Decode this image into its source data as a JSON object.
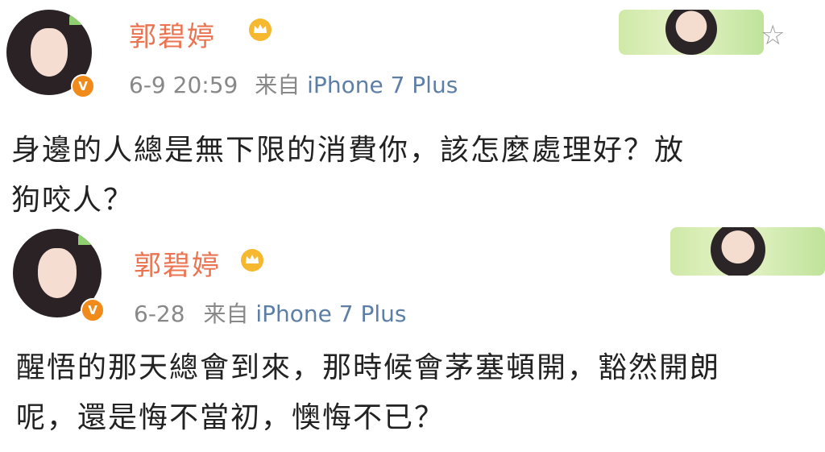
{
  "posts": [
    {
      "username": "郭碧婷",
      "time": "6-9 20:59",
      "via": "来自",
      "source": "iPhone 7 Plus",
      "verified_badge": "V",
      "content_lines": [
        "身邊的人總是無下限的消費你，該怎麼處理好？放",
        "狗咬人？"
      ]
    },
    {
      "username": "郭碧婷",
      "time": "6-28",
      "via": "来自",
      "source": "iPhone 7 Plus",
      "verified_badge": "V",
      "content_lines": [
        "醒悟的那天總會到來，那時候會茅塞頓開，豁然開朗",
        "呢，還是悔不當初，懊悔不已？"
      ]
    }
  ],
  "colors": {
    "name": "#eb7350",
    "meta": "#888888",
    "source": "#5d7fa6",
    "badge": "#f08a1a"
  },
  "icons": [
    "avatar",
    "verified-badge-icon",
    "crown-icon",
    "star-icon",
    "profile-banner"
  ]
}
